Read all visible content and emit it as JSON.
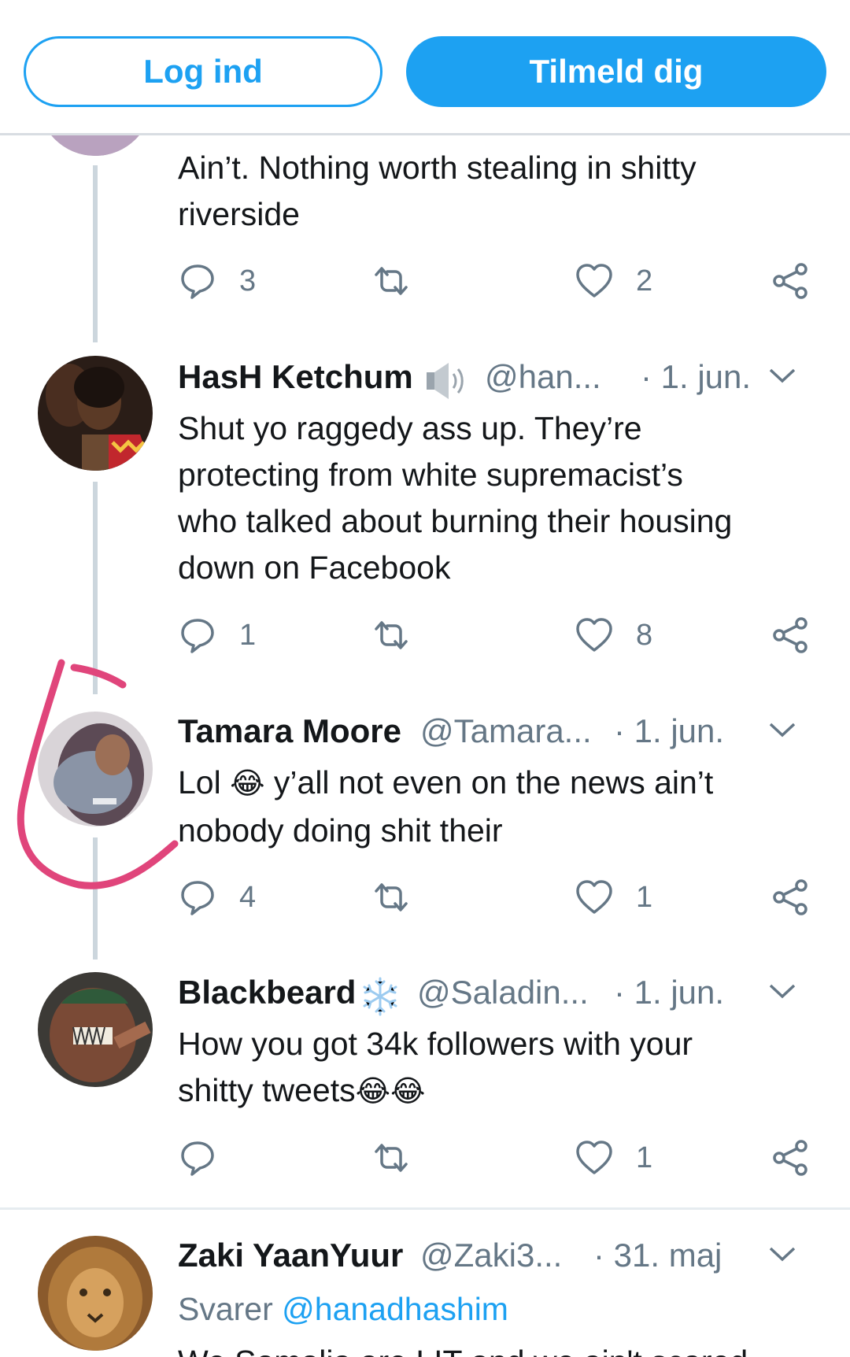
{
  "topbar": {
    "login_label": "Log ind",
    "signup_label": "Tilmeld dig"
  },
  "colors": {
    "accent": "#1da1f2",
    "muted": "#657786",
    "annotation": "#e0457b"
  },
  "tweets": [
    {
      "text_line1": "Ain’t. Nothing worth stealing in shitty",
      "text_line2": "riverside",
      "replies": "3",
      "retweets": "",
      "likes": "2"
    },
    {
      "name": "HasH Ketchum",
      "name_icon": "speaker-icon",
      "handle": "@han...",
      "time": "· 1. jun.",
      "text_lines": [
        "Shut yo raggedy ass up. They’re",
        "protecting from white supremacist’s",
        "who talked about burning their housing",
        "down on Facebook"
      ],
      "replies": "1",
      "likes": "8"
    },
    {
      "name": "Tamara Moore",
      "handle": "@Tamara...",
      "time": "· 1. jun.",
      "text_pre": "Lol ",
      "text_emoji": "😂",
      "text_post": " y’all not even on the news ain’t",
      "text_line2": "nobody doing shit their",
      "replies": "4",
      "likes": "1"
    },
    {
      "name": "Blackbeard",
      "name_icon": "snowflake-icon",
      "handle": "@Saladin...",
      "time": "· 1. jun.",
      "text_line1": "How you got 34k followers with your",
      "text_line2": "shitty tweets",
      "text_emojis": "😂😂",
      "replies": "",
      "likes": "1"
    },
    {
      "name": "Zaki YaanYuur",
      "handle": "@Zaki3...",
      "time": "· 31. maj",
      "reply_to_prefix": "Svarer ",
      "reply_to_handle": "@hanadhashim",
      "text_partial": "We Somalia are LIT and we ain't scared"
    }
  ]
}
